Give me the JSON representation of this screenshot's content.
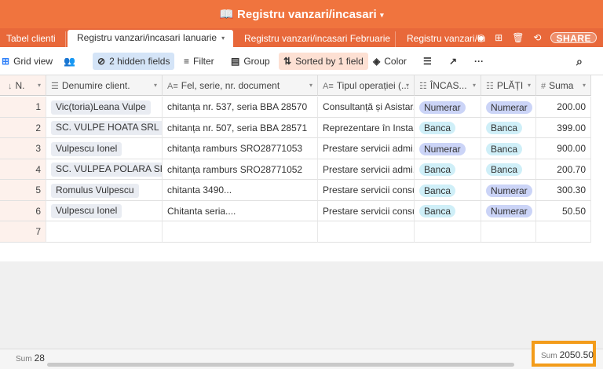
{
  "app": {
    "title": "Registru vanzari/incasari",
    "title_icon": "book-icon"
  },
  "tabs": [
    {
      "label": "Tabel clienti",
      "active": false
    },
    {
      "label": "Registru vanzari/incasari Ianuarie",
      "active": true
    },
    {
      "label": "Registru vanzari/incasari Februarie",
      "active": false
    },
    {
      "label": "Registru vanzari/Ince",
      "active": false
    }
  ],
  "tab_actions": {
    "share_label": "SHARE"
  },
  "toolbar": {
    "view_label": "Grid view",
    "hidden_fields_label": "2 hidden fields",
    "filter_label": "Filter",
    "group_label": "Group",
    "sorted_label": "Sorted by 1 field",
    "color_label": "Color"
  },
  "columns": [
    {
      "label": "N.",
      "icon": "sort-number-icon"
    },
    {
      "label": "Denumire client.",
      "icon": "list-icon"
    },
    {
      "label": "Fel, serie, nr. document",
      "icon": "text-icon"
    },
    {
      "label": "Tipul operației (...",
      "icon": "text-icon"
    },
    {
      "label": "ÎNCAS...",
      "icon": "select-icon"
    },
    {
      "label": "PLĂȚI",
      "icon": "select-icon"
    },
    {
      "label": "Suma",
      "icon": "hash-icon"
    }
  ],
  "rows": [
    {
      "n": "1",
      "client": "Vic(toria)Leana Vulpe",
      "doc": "chitanța nr. 537, seria BBA 28570",
      "op": "Consultanță și Asistar...",
      "incasari": "Numerar",
      "plati": "Numerar",
      "suma": "200.00"
    },
    {
      "n": "2",
      "client": "SC. VULPE HOATA SRL",
      "doc": "chitanța nr. 507, seria BBA 28571",
      "op": "Reprezentare în Insta...",
      "incasari": "Banca",
      "plati": "Banca",
      "suma": "399.00"
    },
    {
      "n": "3",
      "client": "Vulpescu Ionel",
      "doc": "chitanța ramburs SRO28771053",
      "op": "Prestare servicii admi...",
      "incasari": "Numerar",
      "plati": "Banca",
      "suma": "900.00"
    },
    {
      "n": "4",
      "client": "SC. VULPEA POLARA SRL",
      "doc": "chitanța ramburs SRO28771052",
      "op": "Prestare servicii admi...",
      "incasari": "Banca",
      "plati": "Banca",
      "suma": "200.70"
    },
    {
      "n": "5",
      "client": "Romulus Vulpescu",
      "doc": "chitanta 3490...",
      "op": "Prestare servicii consu...",
      "incasari": "Banca",
      "plati": "Numerar",
      "suma": "300.30"
    },
    {
      "n": "6",
      "client": "Vulpescu Ionel",
      "doc": "Chitanta seria....",
      "op": "Prestare servicii consu...",
      "incasari": "Banca",
      "plati": "Numerar",
      "suma": "50.50"
    },
    {
      "n": "7",
      "client": "",
      "doc": "",
      "op": "",
      "incasari": "",
      "plati": "",
      "suma": ""
    }
  ],
  "footer": {
    "sum_label": "Sum",
    "n_sum": "28",
    "suma_sum": "2050.50"
  },
  "colors": {
    "brand": "#f0743e",
    "highlight_box": "#f39c1a",
    "pill_numerar": "#cbd4f7",
    "pill_banca": "#cfeff8"
  }
}
